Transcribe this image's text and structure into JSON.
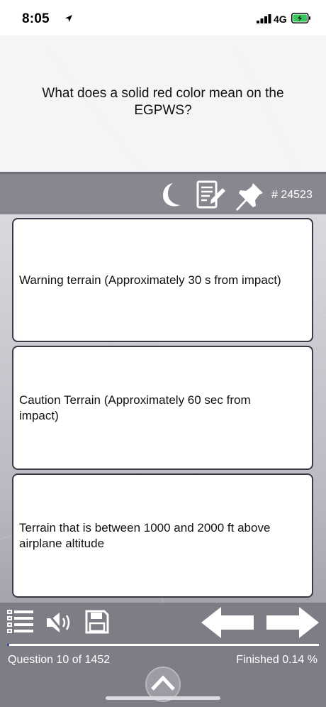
{
  "status_bar": {
    "time": "8:05",
    "network": "4G"
  },
  "question": {
    "text": "What does a solid red color mean on the EGPWS?"
  },
  "toolbar": {
    "question_id": "# 24523",
    "icons": [
      "moon-icon",
      "notes-icon",
      "pin-icon"
    ]
  },
  "answers": [
    {
      "text": "Warning terrain (Approximately 30 s from impact)"
    },
    {
      "text": "Caution Terrain (Approximately 60 sec from impact)"
    },
    {
      "text": "Terrain that is between 1000 and 2000 ft above airplane altitude"
    }
  ],
  "bottom_bar": {
    "icons": [
      "list-icon",
      "mute-icon",
      "save-icon",
      "back-arrow-icon",
      "forward-arrow-icon",
      "chevron-up-icon"
    ],
    "counter": "Question 10 of 1452",
    "finished": "Finished 0.14 %",
    "progress_fraction": 0.0069
  },
  "colors": {
    "toolbar": "#87878f",
    "bottom_bar": "#7d7d86",
    "progress_fill": "#3a4cb8",
    "answer_border": "#3a3a46"
  }
}
